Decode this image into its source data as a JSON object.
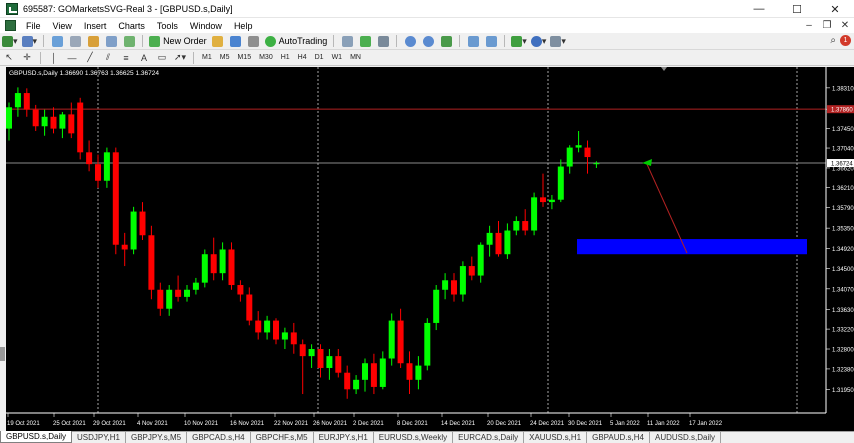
{
  "window": {
    "title": "695587: GOMarketsSVG-Real 3 - [GBPUSD.s,Daily]",
    "min": "—",
    "max": "☐",
    "close": "✕"
  },
  "menu": [
    "File",
    "View",
    "Insert",
    "Charts",
    "Tools",
    "Window",
    "Help"
  ],
  "mdi": {
    "min": "–",
    "restore": "❐",
    "close": "✕"
  },
  "toolbar": {
    "new_order": "New Order",
    "auto_trading": "AutoTrading",
    "timeframes": [
      "M1",
      "M5",
      "M15",
      "M30",
      "H1",
      "H4",
      "D1",
      "W1",
      "MN"
    ],
    "user_badge": "1"
  },
  "chart_info": "GBPUSD.s,Daily  1.36690 1.36763 1.36625 1.36724",
  "chart_data": {
    "type": "candlestick",
    "symbol": "GBPUSD.s",
    "timeframe": "Daily",
    "ylim": [
      1.3145,
      1.3875
    ],
    "y_ticks": [
      "1.38310",
      "1.37860",
      "1.37450",
      "1.37040",
      "1.36620",
      "1.36210",
      "1.35790",
      "1.35350",
      "1.34920",
      "1.34500",
      "1.34070",
      "1.33630",
      "1.33220",
      "1.32800",
      "1.32380",
      "1.31950"
    ],
    "x_labels": [
      "19 Oct 2021",
      "25 Oct 2021",
      "29 Oct 2021",
      "4 Nov 2021",
      "10 Nov 2021",
      "16 Nov 2021",
      "22 Nov 2021",
      "26 Nov 2021",
      "2 Dec 2021",
      "8 Dec 2021",
      "14 Dec 2021",
      "20 Dec 2021",
      "24 Dec 2021",
      "30 Dec 2021",
      "5 Jan 2022",
      "11 Jan 2022",
      "17 Jan 2022"
    ],
    "resistance_level": 1.3786,
    "resistance_label": "1.37860",
    "current_price": 1.36724,
    "current_label": "1.36724",
    "demand_zone": [
      1.348,
      1.3512
    ],
    "candles": [
      [
        1.3745,
        1.38,
        1.372,
        1.379
      ],
      [
        1.379,
        1.3832,
        1.377,
        1.382
      ],
      [
        1.382,
        1.383,
        1.377,
        1.3785
      ],
      [
        1.3785,
        1.3795,
        1.374,
        1.375
      ],
      [
        1.375,
        1.3785,
        1.373,
        1.377
      ],
      [
        1.377,
        1.379,
        1.3735,
        1.3745
      ],
      [
        1.3745,
        1.378,
        1.3725,
        1.3775
      ],
      [
        1.3775,
        1.38,
        1.3725,
        1.3735
      ],
      [
        1.38,
        1.381,
        1.368,
        1.3695
      ],
      [
        1.3695,
        1.372,
        1.3655,
        1.367
      ],
      [
        1.367,
        1.369,
        1.362,
        1.3635
      ],
      [
        1.3635,
        1.3705,
        1.362,
        1.3695
      ],
      [
        1.3695,
        1.3705,
        1.348,
        1.35
      ],
      [
        1.35,
        1.3525,
        1.3455,
        1.349
      ],
      [
        1.349,
        1.358,
        1.348,
        1.357
      ],
      [
        1.357,
        1.359,
        1.351,
        1.352
      ],
      [
        1.352,
        1.354,
        1.3385,
        1.3405
      ],
      [
        1.3405,
        1.342,
        1.335,
        1.3365
      ],
      [
        1.3365,
        1.3415,
        1.335,
        1.3405
      ],
      [
        1.3405,
        1.3435,
        1.338,
        1.339
      ],
      [
        1.339,
        1.3415,
        1.338,
        1.3405
      ],
      [
        1.3405,
        1.343,
        1.3395,
        1.342
      ],
      [
        1.342,
        1.349,
        1.341,
        1.348
      ],
      [
        1.348,
        1.3515,
        1.3425,
        1.344
      ],
      [
        1.344,
        1.3505,
        1.3425,
        1.349
      ],
      [
        1.349,
        1.3505,
        1.3405,
        1.3415
      ],
      [
        1.3415,
        1.3425,
        1.338,
        1.3395
      ],
      [
        1.3395,
        1.341,
        1.333,
        1.334
      ],
      [
        1.334,
        1.336,
        1.33,
        1.3315
      ],
      [
        1.3315,
        1.335,
        1.33,
        1.334
      ],
      [
        1.334,
        1.3345,
        1.329,
        1.33
      ],
      [
        1.33,
        1.3325,
        1.328,
        1.3315
      ],
      [
        1.3315,
        1.3335,
        1.327,
        1.329
      ],
      [
        1.329,
        1.33,
        1.3185,
        1.3265
      ],
      [
        1.3265,
        1.329,
        1.324,
        1.328
      ],
      [
        1.328,
        1.329,
        1.322,
        1.324
      ],
      [
        1.324,
        1.328,
        1.3215,
        1.3265
      ],
      [
        1.3265,
        1.328,
        1.322,
        1.323
      ],
      [
        1.323,
        1.3245,
        1.3175,
        1.3195
      ],
      [
        1.3195,
        1.3225,
        1.3185,
        1.3215
      ],
      [
        1.3215,
        1.326,
        1.319,
        1.325
      ],
      [
        1.325,
        1.327,
        1.3185,
        1.32
      ],
      [
        1.32,
        1.3275,
        1.3195,
        1.326
      ],
      [
        1.326,
        1.3355,
        1.3245,
        1.334
      ],
      [
        1.334,
        1.3365,
        1.324,
        1.325
      ],
      [
        1.325,
        1.3275,
        1.3185,
        1.3215
      ],
      [
        1.3215,
        1.3265,
        1.3195,
        1.3245
      ],
      [
        1.3245,
        1.3345,
        1.3235,
        1.3335
      ],
      [
        1.3335,
        1.3415,
        1.332,
        1.3405
      ],
      [
        1.3405,
        1.344,
        1.3385,
        1.3425
      ],
      [
        1.3425,
        1.344,
        1.338,
        1.3395
      ],
      [
        1.3395,
        1.3465,
        1.338,
        1.3455
      ],
      [
        1.3455,
        1.3475,
        1.3425,
        1.3435
      ],
      [
        1.3435,
        1.3505,
        1.342,
        1.35
      ],
      [
        1.35,
        1.354,
        1.3475,
        1.3525
      ],
      [
        1.3525,
        1.355,
        1.3475,
        1.348
      ],
      [
        1.348,
        1.3545,
        1.347,
        1.353
      ],
      [
        1.353,
        1.356,
        1.352,
        1.355
      ],
      [
        1.355,
        1.3575,
        1.352,
        1.353
      ],
      [
        1.353,
        1.361,
        1.352,
        1.36
      ],
      [
        1.36,
        1.365,
        1.358,
        1.359
      ],
      [
        1.359,
        1.3605,
        1.3575,
        1.3595
      ],
      [
        1.3595,
        1.368,
        1.359,
        1.3665
      ],
      [
        1.3665,
        1.371,
        1.365,
        1.3705
      ],
      [
        1.3705,
        1.374,
        1.3695,
        1.371
      ],
      [
        1.3705,
        1.372,
        1.365,
        1.3685
      ],
      [
        1.367,
        1.3676,
        1.3662,
        1.3672
      ]
    ]
  },
  "tabs": [
    "GBPUSD.s,Daily",
    "USDJPY,H1",
    "GBPJPY.s,M5",
    "GBPCAD.s,H4",
    "GBPCHF.s,M5",
    "EURJPY.s,H1",
    "EURUSD.s,Weekly",
    "EURCAD.s,Daily",
    "XAUUSD.s,H1",
    "GBPAUD.s,H4",
    "AUDUSD.s,Daily"
  ]
}
